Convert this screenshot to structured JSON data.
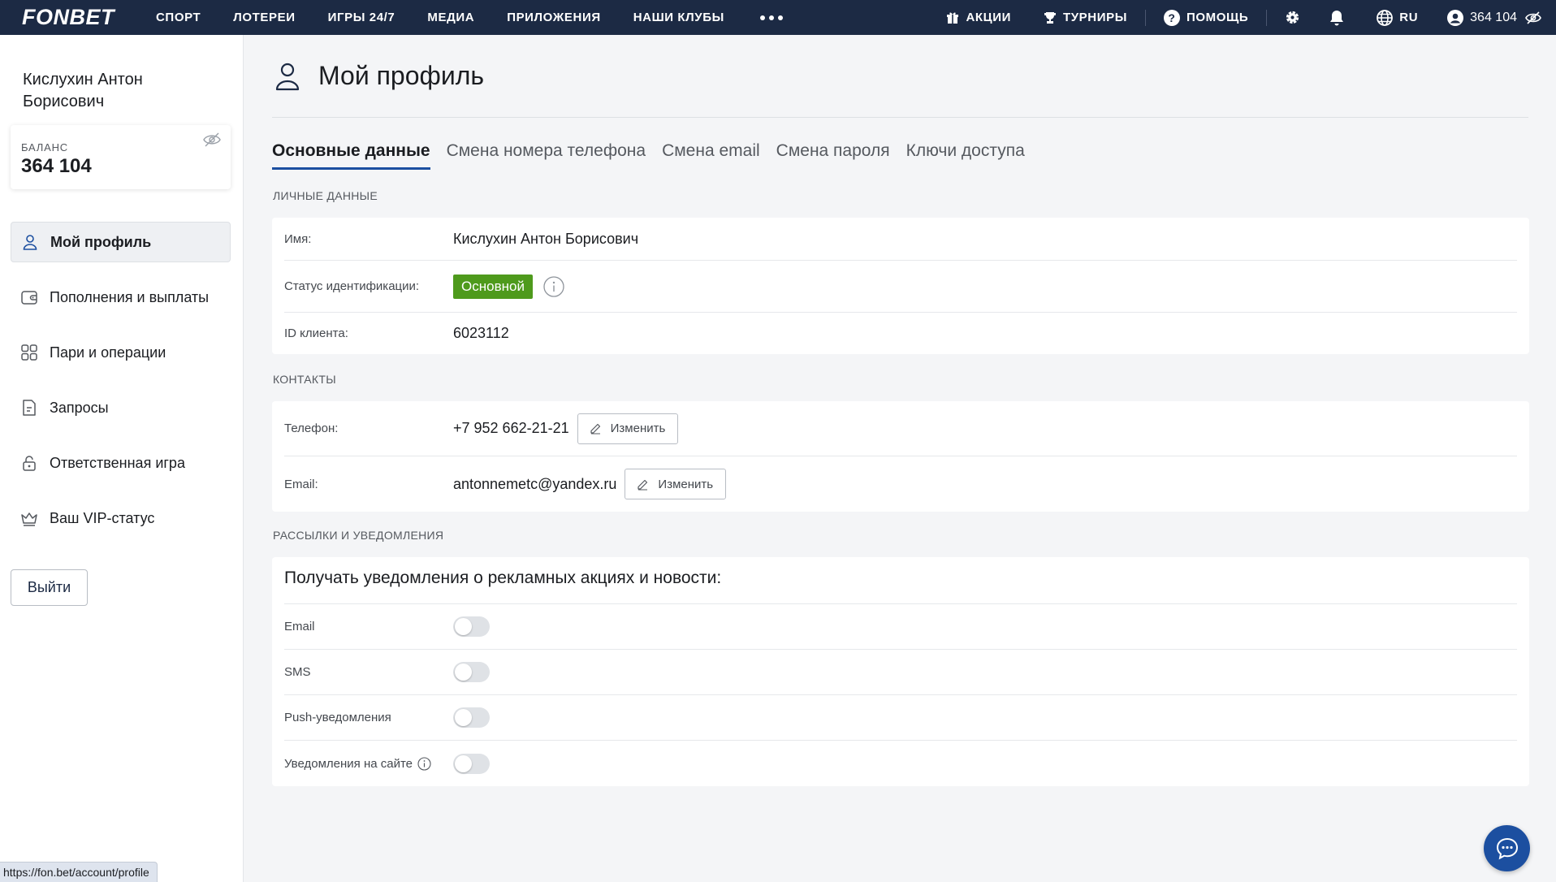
{
  "topnav": {
    "logo": "FONBET",
    "links": [
      "СПОРТ",
      "ЛОТЕРЕИ",
      "ИГРЫ 24/7",
      "МЕДИА",
      "ПРИЛОЖЕНИЯ",
      "НАШИ КЛУБЫ"
    ],
    "promotions": "АКЦИИ",
    "tournaments": "ТУРНИРЫ",
    "help": "ПОМОЩЬ",
    "language": "RU",
    "balance": "364 104"
  },
  "sidebar": {
    "user_name": "Кислухин Антон Борисович",
    "balance_label": "БАЛАНС",
    "balance_value": "364 104",
    "menu": [
      {
        "label": "Мой профиль",
        "icon": "user-icon"
      },
      {
        "label": "Пополнения и выплаты",
        "icon": "wallet-icon"
      },
      {
        "label": "Пари и операции",
        "icon": "grid-icon"
      },
      {
        "label": "Запросы",
        "icon": "document-icon"
      },
      {
        "label": "Ответственная игра",
        "icon": "lock-icon"
      },
      {
        "label": "Ваш VIP-статус",
        "icon": "crown-icon"
      }
    ],
    "logout": "Выйти"
  },
  "main": {
    "title": "Мой профиль",
    "tabs": [
      "Основные данные",
      "Смена номера телефона",
      "Смена email",
      "Смена пароля",
      "Ключи доступа"
    ],
    "personal": {
      "title": "ЛИЧНЫЕ ДАННЫЕ",
      "name_label": "Имя:",
      "name_value": "Кислухин Антон Борисович",
      "status_label": "Статус идентификации:",
      "status_value": "Основной",
      "id_label": "ID клиента:",
      "id_value": "6023112"
    },
    "contacts": {
      "title": "КОНТАКТЫ",
      "phone_label": "Телефон:",
      "phone_value": "+7 952 662-21-21",
      "email_label": "Email:",
      "email_value": "antonnemetc@yandex.ru",
      "edit_label": "Изменить"
    },
    "notifications": {
      "title": "РАССЫЛКИ И УВЕДОМЛЕНИЯ",
      "heading": "Получать уведомления о рекламных акциях и новости:",
      "items": [
        "Email",
        "SMS",
        "Push-уведомления",
        "Уведомления на сайте"
      ]
    }
  },
  "status_url": "https://fon.bet/account/profile",
  "colors": {
    "topbar": "#1c2a44",
    "accent": "#1c4fa0",
    "badge_green": "#4e9a1c"
  }
}
